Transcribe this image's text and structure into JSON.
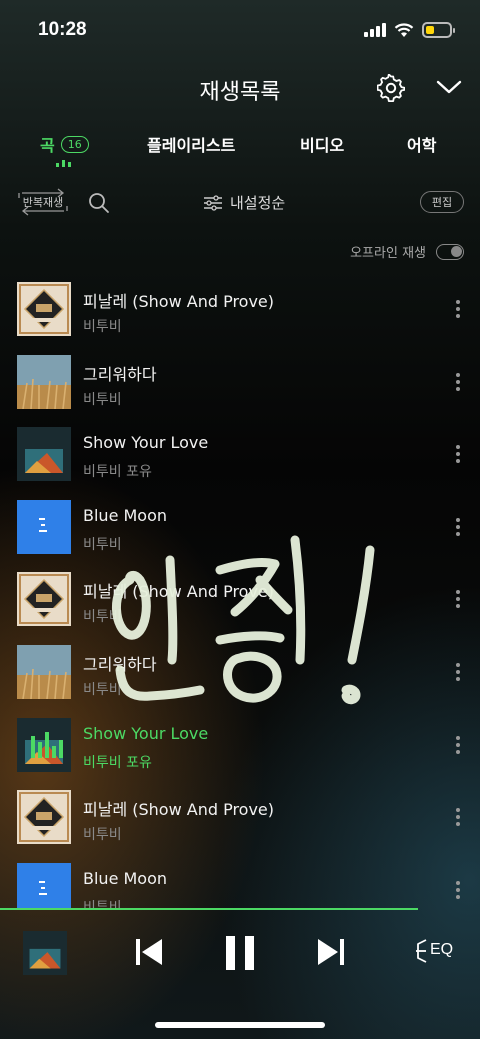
{
  "status_bar": {
    "time": "10:28"
  },
  "header": {
    "title": "재생목록"
  },
  "tabs": [
    {
      "label": "곡",
      "count": "16"
    },
    {
      "label": "플레이리스트"
    },
    {
      "label": "비디오"
    },
    {
      "label": "어학"
    }
  ],
  "toolbar": {
    "repeat_label": "반복재생",
    "sort_label": "내설정순",
    "edit_label": "편집"
  },
  "offline": {
    "label": "오프라인 재생",
    "enabled": false
  },
  "songs": [
    {
      "title": "피날레 (Show And Prove)",
      "artist": "비투비",
      "cover": "finale"
    },
    {
      "title": "그리워하다",
      "artist": "비투비",
      "cover": "wheat"
    },
    {
      "title": "Show Your Love",
      "artist": "비투비 포유",
      "cover": "inside"
    },
    {
      "title": "Blue Moon",
      "artist": "비투비",
      "cover": "blue"
    },
    {
      "title": "피날레 (Show And Prove)",
      "artist": "비투비",
      "cover": "finale"
    },
    {
      "title": "그리워하다",
      "artist": "비투비",
      "cover": "wheat"
    },
    {
      "title": "Show Your Love",
      "artist": "비투비 포유",
      "cover": "inside",
      "playing": true
    },
    {
      "title": "피날레 (Show And Prove)",
      "artist": "비투비",
      "cover": "finale"
    },
    {
      "title": "Blue Moon",
      "artist": "비투비",
      "cover": "blue"
    }
  ],
  "player": {
    "eq_label": "EQ",
    "progress": 0.87
  },
  "colors": {
    "accent": "#4cd964",
    "background": "#050505"
  }
}
